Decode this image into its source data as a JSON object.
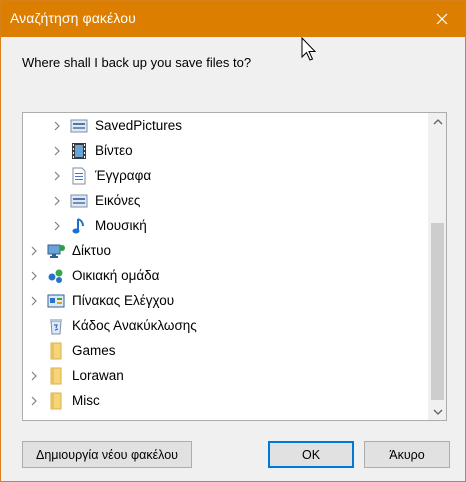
{
  "window": {
    "title": "Αναζήτηση φακέλου",
    "titlebar_color": "#dc7e00"
  },
  "prompt": "Where shall I back up you save files to?",
  "tree": {
    "items": [
      {
        "label": "SavedPictures",
        "icon": "library-icon",
        "expandable": true
      },
      {
        "label": "Βίντεο",
        "icon": "video-library-icon",
        "expandable": true
      },
      {
        "label": "Έγγραφα",
        "icon": "documents-library-icon",
        "expandable": true
      },
      {
        "label": "Εικόνες",
        "icon": "pictures-library-icon",
        "expandable": true
      },
      {
        "label": "Μουσική",
        "icon": "music-library-icon",
        "expandable": true
      },
      {
        "label": "Δίκτυο",
        "icon": "network-icon",
        "expandable": true
      },
      {
        "label": "Οικιακή ομάδα",
        "icon": "homegroup-icon",
        "expandable": true
      },
      {
        "label": "Πίνακας Ελέγχου",
        "icon": "control-panel-icon",
        "expandable": true
      },
      {
        "label": "Κάδος Ανακύκλωσης",
        "icon": "recycle-bin-icon",
        "expandable": false
      },
      {
        "label": "Games",
        "icon": "folder-icon",
        "expandable": false
      },
      {
        "label": "Lorawan",
        "icon": "folder-icon",
        "expandable": true
      },
      {
        "label": "Misc",
        "icon": "folder-icon",
        "expandable": true
      }
    ]
  },
  "buttons": {
    "new_folder": "Δημιουργία νέου φακέλου",
    "ok": "OK",
    "cancel": "Άκυρο"
  },
  "colors": {
    "accent": "#0078d7",
    "folder": "#f5d47a"
  }
}
